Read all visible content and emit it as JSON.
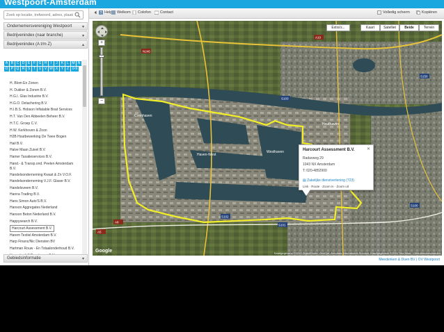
{
  "app": {
    "title": "Westpoort-Amsterdam"
  },
  "search": {
    "placeholder": "Zoek op locatie, trefwoord, adres, plaats"
  },
  "sidebar": {
    "sections": [
      {
        "label": "Ondernemersvereniging Westpoort"
      },
      {
        "label": "Bedrijvenindex (naar branche)"
      },
      {
        "label": "Bedrijvenindex (A t/m Z)"
      },
      {
        "label": "Gebiedsinformatie"
      }
    ],
    "letters_row1": [
      "A",
      "B",
      "C",
      "D",
      "E",
      "F",
      "G",
      "H",
      "I",
      "J",
      "K",
      "L",
      "M",
      "N"
    ],
    "letters_row2": [
      "O",
      "P",
      "Q",
      "R",
      "S",
      "T",
      "U",
      "V",
      "W",
      "X",
      "Y",
      "Z",
      "0-9"
    ],
    "companies": [
      "H. Blom En Zonen",
      "H. Dukker & Zonen B.V.",
      "H.G.I. Glas Industrie B.V.",
      "H.G.O. Detachering B.V.",
      "H.I.B.S. Hobson Inflatable Boat Services",
      "H.T. Van Den Abbeelen Beheer B.V.",
      "H.T.C. Groep C.V.",
      "H.W. Kerkhoven & Zoon",
      "H2B Houtbewerking De Twee Bogen",
      "Hail B.V.",
      "Halve Maan Zuivel B.V.",
      "Hamer Taxatieservices B.V.",
      "Hand.- & Transp.ond. Peelen Amsterdam B.V.",
      "Handelsonderneming Kwast & Zn V.O.F.",
      "Handelsonderneming V.J.F. Glaser B.V.",
      "Handelsveem B.V.",
      "Hanna Trading B.V.",
      "Hans Simon Auto'S B.V.",
      "Hanson Aggregates Nederland",
      "Hanson Beton Nederland B.V.",
      "Happysearch B.V.",
      "Harcourt Assessment B.V.",
      "Harem Textiel Amsterdam B.V.",
      "Harp Financ/Nic Diensten BV",
      "Hartman Rouw - En Totaalonderhoud B.V.",
      "Havenbedrijf Coenhaven B.V."
    ]
  },
  "toolbar": {
    "help": "Help",
    "welkom": "Welkom",
    "colofon": "Colofon",
    "contact": "Contact",
    "fullscreen": "Volledig scherm",
    "copy": "Kopiëren"
  },
  "map": {
    "extras": "Extra's...",
    "types": [
      "Kaart",
      "Satelliet",
      "Beide",
      "Terrein"
    ],
    "active_type": "Beide",
    "labels": {
      "haven_west": "Haven-West",
      "haven_oost": "Westhaven",
      "coenhaven": "Coenhaven",
      "houthaven": "Houthaven"
    },
    "roads": [
      "N246",
      "A10",
      "A5",
      "S103",
      "S102",
      "S100",
      "A8",
      "S101",
      "S150"
    ],
    "copyright": "Kaartgegevens ©2010 DigitalGlobe, GeoEye, Aerodata International Surveys, Kaartgegevens ©2010 Tele Atlas - Gebruiksvoorwaarden",
    "logo": "Google"
  },
  "popup": {
    "title": "Harcourt Assessment B.V.",
    "street": "Radarweg 29",
    "city": "1043 NX Amsterdam",
    "phone": "T: 020-4852900",
    "link": "Zakelijke dienstverlening (723)",
    "actions": [
      "Link",
      "Route",
      "Zoom in",
      "Zoom uit"
    ]
  },
  "footer": {
    "credits": "Meedenken & Doen BV | OV Westpoort"
  },
  "colors": {
    "accent": "#1aa7e0",
    "boundary": "#f2ee29",
    "water": "#2f4b55"
  }
}
